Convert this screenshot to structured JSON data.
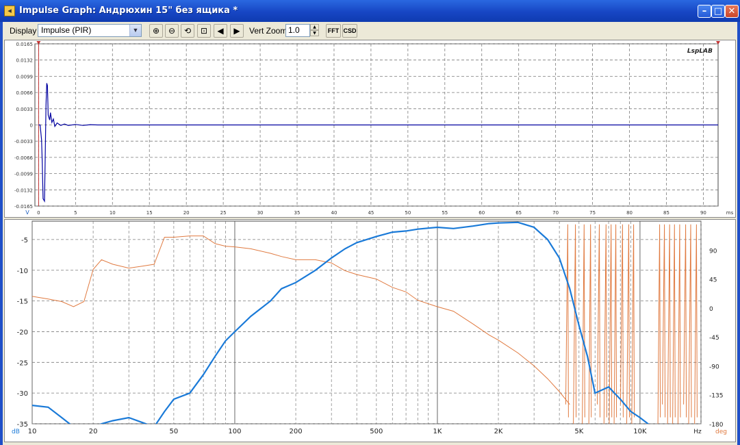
{
  "window": {
    "title": "Impulse Graph: Андрюхин 15\" без ящика *",
    "icon": "speaker-icon",
    "controls": [
      "minimize-icon",
      "maximize-icon",
      "close-icon"
    ]
  },
  "toolbar": {
    "display_label": "Display",
    "display_value": "Impulse (PIR)",
    "zoom_in_icon": "zoom-in-icon",
    "zoom_out_icon": "zoom-out-icon",
    "zoom_reset_icon": "zoom-reset-icon",
    "zoom_fit_icon": "zoom-fit-icon",
    "prev_icon": "triangle-left-icon",
    "next_icon": "triangle-right-icon",
    "vert_zoom_label": "Vert Zoom",
    "vert_zoom_value": "1.0",
    "fft_label": "FFT",
    "csd_label": "CSD"
  },
  "impulse_panel": {
    "logo": "LspLAB",
    "y_unit": "V",
    "x_unit": "ms"
  },
  "freq_panel": {
    "y_left_unit": "dB",
    "x_unit": "Hz",
    "y_right_unit": "deg"
  },
  "colors": {
    "impulse_trace": "#0000a0",
    "magnitude_trace": "#1a7ad8",
    "phase_trace": "#e07a40",
    "grid": "#7a7a7a",
    "titlebar": "#1f4fc8"
  },
  "chart_data": [
    {
      "type": "line",
      "name": "impulse",
      "xlabel": "ms",
      "ylabel": "V",
      "xlim": [
        -0.5,
        92
      ],
      "ylim": [
        -0.0165,
        0.0165
      ],
      "x_ticks": [
        "0",
        "5",
        "10",
        "15",
        "20",
        "25",
        "30",
        "35",
        "40",
        "45",
        "50",
        "55",
        "60",
        "65",
        "70",
        "75",
        "80",
        "85",
        "90"
      ],
      "y_ticks": [
        "0.0165",
        "0.0132",
        "0.0099",
        "0.0066",
        "0.0033",
        "0",
        "-0.0033",
        "-0.0066",
        "-0.0099",
        "-0.0132",
        "-0.0165"
      ],
      "series": [
        {
          "x": [
            0,
            0.2,
            0.4,
            0.5,
            0.6,
            0.8,
            0.9,
            1.0,
            1.1,
            1.2,
            1.3,
            1.5,
            1.6,
            1.8,
            2.0,
            2.2,
            2.5,
            3.0,
            3.5,
            4.0,
            5.0,
            6.0,
            7.0,
            8.0,
            10,
            15,
            20,
            30,
            40,
            50,
            60,
            70,
            80,
            90,
            92
          ],
          "y": [
            0,
            0,
            -0.003,
            -0.008,
            -0.015,
            -0.0155,
            -0.006,
            0.004,
            0.0085,
            0.008,
            0.002,
            0.001,
            0.0025,
            0.0005,
            0.0012,
            -0.0003,
            0.0004,
            -0.0001,
            0.0002,
            -0.0001,
            0.0001,
            -0.0001,
            5e-05,
            0,
            0,
            0,
            0,
            0,
            0,
            0,
            0,
            0,
            0,
            0,
            0
          ]
        }
      ]
    },
    {
      "type": "line",
      "name": "frequency_response",
      "xlabel": "Hz",
      "ylabel": "dB",
      "y2label": "deg",
      "x_scale": "log",
      "xlim": [
        10,
        20000
      ],
      "ylim": [
        -35,
        -2
      ],
      "y2lim": [
        -180,
        135
      ],
      "x_ticks": [
        "10",
        "20",
        "50",
        "100",
        "200",
        "500",
        "1K",
        "2K",
        "5K",
        "10K"
      ],
      "y_ticks": [
        "-5",
        "-10",
        "-15",
        "-20",
        "-25",
        "-30",
        "-35"
      ],
      "y2_ticks": [
        "90",
        "45",
        "0",
        "-45",
        "-90",
        "-135",
        "-180"
      ],
      "series": [
        {
          "name": "magnitude",
          "axis": "left",
          "x": [
            10,
            12,
            14,
            16,
            18,
            20,
            22,
            25,
            30,
            35,
            40,
            45,
            50,
            60,
            70,
            80,
            90,
            100,
            120,
            150,
            170,
            200,
            250,
            300,
            350,
            400,
            500,
            600,
            700,
            800,
            1000,
            1200,
            1500,
            1800,
            2000,
            2500,
            3000,
            3500,
            4000,
            4500,
            5000,
            5500,
            6000,
            7000,
            8000,
            9000,
            10000,
            12000,
            15000,
            20000
          ],
          "y": [
            -32,
            -32.3,
            -34,
            -35.5,
            -36,
            -35.5,
            -35,
            -34.5,
            -34,
            -34.8,
            -35.5,
            -33,
            -31,
            -30,
            -27,
            -24,
            -21.5,
            -20,
            -17.5,
            -15,
            -13,
            -12,
            -10,
            -8,
            -6.5,
            -5.5,
            -4.5,
            -3.8,
            -3.6,
            -3.3,
            -3.0,
            -3.2,
            -2.8,
            -2.4,
            -2.3,
            -2.2,
            -3,
            -5,
            -8,
            -13,
            -19,
            -24,
            -30,
            -29,
            -31,
            -33,
            -34,
            -36,
            -37,
            -38
          ]
        },
        {
          "name": "phase",
          "axis": "right",
          "x": [
            10,
            12,
            14,
            16,
            18,
            20,
            22,
            25,
            30,
            35,
            40,
            45,
            50,
            60,
            70,
            80,
            90,
            100,
            120,
            150,
            170,
            200,
            250,
            300,
            350,
            400,
            500,
            600,
            700,
            800,
            1000,
            1200,
            1500,
            1800,
            2000,
            2500,
            3000,
            3500,
            4000,
            4500
          ],
          "y": [
            18,
            14,
            10,
            2,
            10,
            60,
            75,
            68,
            62,
            65,
            68,
            110,
            110,
            112,
            112,
            100,
            96,
            95,
            92,
            85,
            80,
            75,
            75,
            70,
            58,
            52,
            45,
            32,
            25,
            12,
            2,
            -5,
            -25,
            -42,
            -50,
            -70,
            -90,
            -110,
            -130,
            -150
          ]
        }
      ]
    }
  ]
}
